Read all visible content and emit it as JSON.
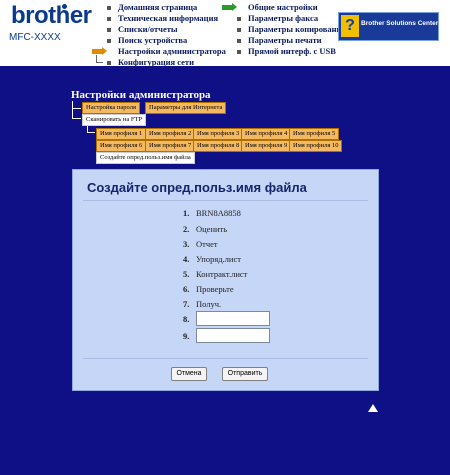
{
  "header": {
    "logo": "brother",
    "model": "MFC-XXXX",
    "nav_left": [
      {
        "label": "Домашняя страница"
      },
      {
        "label": "Техническая информация"
      },
      {
        "label": "Списки/отчеты"
      },
      {
        "label": "Поиск устройства"
      },
      {
        "label": "Настройки администратора"
      },
      {
        "label": "Конфигурация сети"
      }
    ],
    "nav_right": [
      {
        "label": "Общие настройки"
      },
      {
        "label": "Параметры факса"
      },
      {
        "label": "Параметры копирования"
      },
      {
        "label": "Параметры печати"
      },
      {
        "label": "Прямой интерф. с USB"
      }
    ],
    "solutions_center": "Brother Solutions Center",
    "solutions_icon": "?"
  },
  "admin": {
    "title": "Настройки администратора",
    "tabs_row1": [
      "Настройка пароля",
      "Параметры для Интернета"
    ],
    "tab_ftp": "Сканировать на FTP",
    "profiles_row1": [
      "Имя профиля 1",
      "Имя профиля 2",
      "Имя профиля 3",
      "Имя профиля 4",
      "Имя профиля 5"
    ],
    "profiles_row2": [
      "Имя профиля 6",
      "Имя профиля 7",
      "Имя профиля 8",
      "Имя профиля 9",
      "Имя профиля 10"
    ],
    "tab_custom": "Создайте опред.польз.имя файла"
  },
  "form": {
    "title": "Создайте опред.польз.имя файла",
    "items": [
      {
        "num": "1.",
        "label": "BRN8A8858"
      },
      {
        "num": "2.",
        "label": "Оценить"
      },
      {
        "num": "3.",
        "label": "Отчет"
      },
      {
        "num": "4.",
        "label": "Упоряд.лист"
      },
      {
        "num": "5.",
        "label": "Контракт.лист"
      },
      {
        "num": "6.",
        "label": "Проверьте"
      },
      {
        "num": "7.",
        "label": "Получ."
      }
    ],
    "field8_num": "8.",
    "field8_value": "",
    "field9_num": "9.",
    "field9_value": "",
    "cancel_label": "Отмена",
    "submit_label": "Отправить"
  }
}
